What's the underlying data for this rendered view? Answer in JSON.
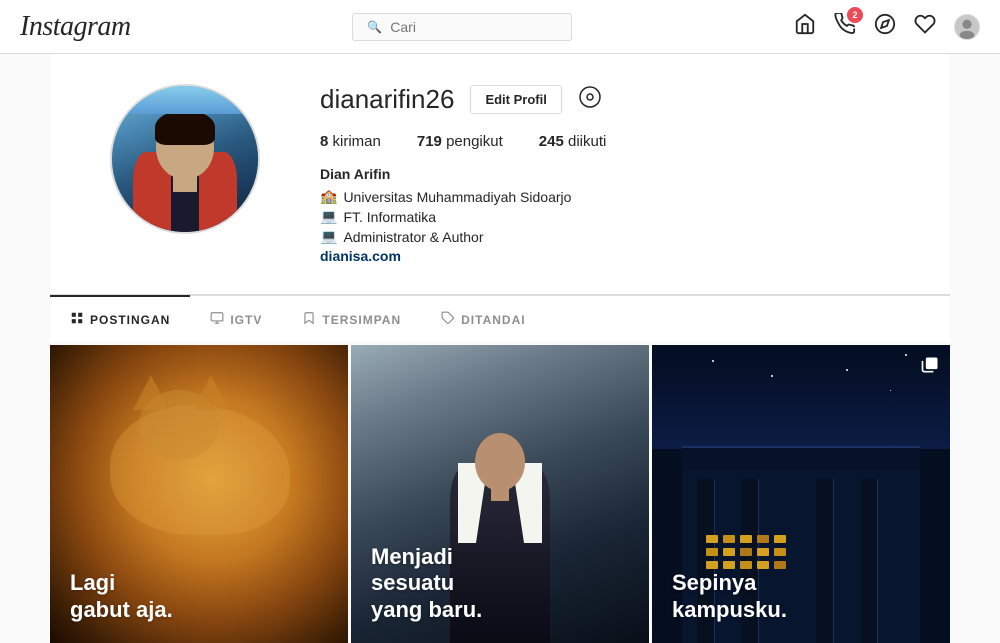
{
  "header": {
    "logo": "Instagram",
    "search": {
      "placeholder": "Cari"
    },
    "nav": {
      "home_icon": "🏠",
      "activity_icon": "✈",
      "activity_badge": "2",
      "explore_icon": "🧭",
      "heart_icon": "♡",
      "avatar_alt": "profile avatar"
    }
  },
  "profile": {
    "username": "dianarifin26",
    "edit_button": "Edit Profil",
    "stats": {
      "posts_label": "kiriman",
      "posts_count": "8",
      "followers_label": "pengikut",
      "followers_count": "719",
      "following_label": "diikuti",
      "following_count": "245"
    },
    "name": "Dian Arifin",
    "bio_line1_icon": "🏫",
    "bio_line1": "Universitas Muhammadiyah Sidoarjo",
    "bio_line2_icon": "💻",
    "bio_line2": "FT. Informatika",
    "bio_line3_icon": "💻",
    "bio_line3": "Administrator & Author",
    "link": "dianisa.com"
  },
  "tabs": [
    {
      "id": "postingan",
      "label": "POSTINGAN",
      "icon": "⊞",
      "active": true
    },
    {
      "id": "igtv",
      "label": "IGTV",
      "icon": "📺",
      "active": false
    },
    {
      "id": "tersimpan",
      "label": "TERSIMPAN",
      "icon": "🔖",
      "active": false
    },
    {
      "id": "ditandai",
      "label": "DITANDAI",
      "icon": "🏷",
      "active": false
    }
  ],
  "posts": [
    {
      "id": "post1",
      "text": "Lagi\ngabut aja.",
      "type": "image",
      "theme": "cat"
    },
    {
      "id": "post2",
      "text": "Menjadi\nsesuatu\nyang baru.",
      "type": "image",
      "theme": "suit"
    },
    {
      "id": "post3",
      "text": "Sepinya\nkampusku.",
      "type": "multiple",
      "theme": "building"
    }
  ]
}
